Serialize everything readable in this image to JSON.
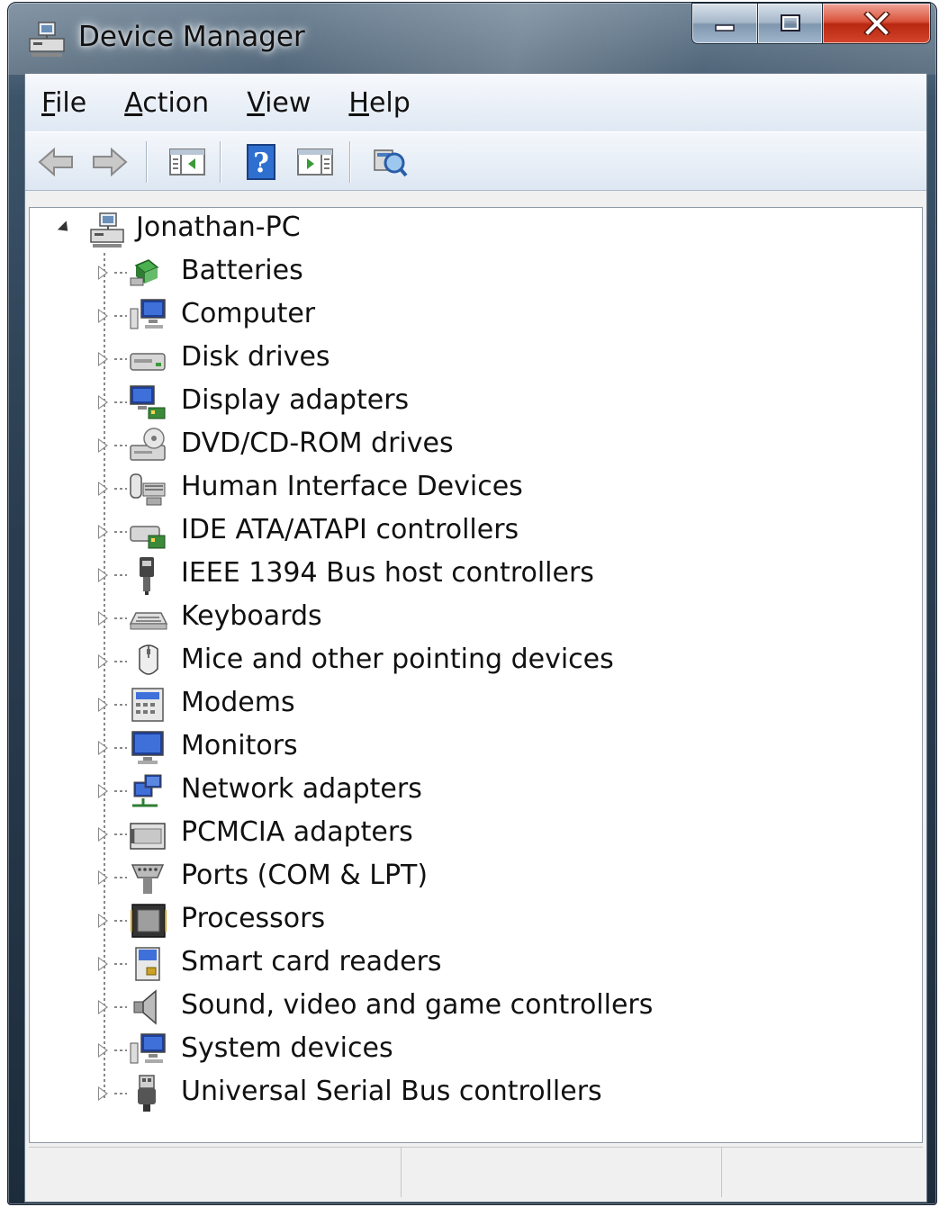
{
  "window": {
    "title": "Device Manager"
  },
  "menu": [
    {
      "label": "File",
      "accel": "F",
      "rest": "ile"
    },
    {
      "label": "Action",
      "accel": "A",
      "rest": "ction"
    },
    {
      "label": "View",
      "accel": "V",
      "rest": "iew"
    },
    {
      "label": "Help",
      "accel": "H",
      "rest": "elp"
    }
  ],
  "toolbar": {
    "buttons": [
      "back-icon",
      "forward-icon",
      "show-hide-console-tree-icon",
      "help-icon",
      "show-hide-action-pane-icon",
      "scan-hardware-changes-icon"
    ]
  },
  "tree": {
    "root": "Jonathan-PC",
    "items": [
      {
        "label": "Batteries",
        "icon": "batteries-icon"
      },
      {
        "label": "Computer",
        "icon": "computer-icon"
      },
      {
        "label": "Disk drives",
        "icon": "disk-drive-icon"
      },
      {
        "label": "Display adapters",
        "icon": "display-adapter-icon"
      },
      {
        "label": "DVD/CD-ROM drives",
        "icon": "dvd-drive-icon"
      },
      {
        "label": "Human Interface Devices",
        "icon": "hid-icon"
      },
      {
        "label": "IDE ATA/ATAPI controllers",
        "icon": "ide-controller-icon"
      },
      {
        "label": "IEEE 1394 Bus host controllers",
        "icon": "ieee1394-icon"
      },
      {
        "label": "Keyboards",
        "icon": "keyboard-icon"
      },
      {
        "label": "Mice and other pointing devices",
        "icon": "mouse-icon"
      },
      {
        "label": "Modems",
        "icon": "modem-icon"
      },
      {
        "label": "Monitors",
        "icon": "monitor-icon"
      },
      {
        "label": "Network adapters",
        "icon": "network-adapter-icon"
      },
      {
        "label": "PCMCIA adapters",
        "icon": "pcmcia-icon"
      },
      {
        "label": "Ports (COM & LPT)",
        "icon": "port-icon"
      },
      {
        "label": "Processors",
        "icon": "processor-icon"
      },
      {
        "label": "Smart card readers",
        "icon": "smart-card-icon"
      },
      {
        "label": "Sound, video and game controllers",
        "icon": "speaker-icon"
      },
      {
        "label": "System devices",
        "icon": "system-devices-icon"
      },
      {
        "label": "Universal Serial Bus controllers",
        "icon": "usb-icon"
      }
    ]
  },
  "colors": {
    "titlebar": "#2b3e52",
    "close_button": "#c8321b",
    "client_background": "#f0f0f0",
    "tree_background": "#ffffff"
  }
}
